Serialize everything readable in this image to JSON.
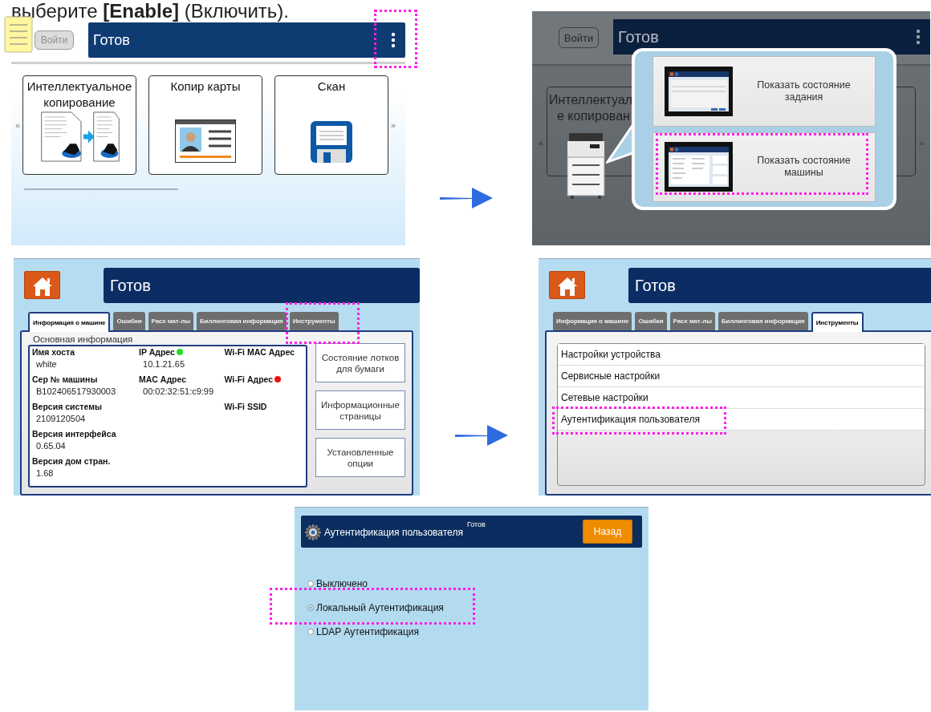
{
  "instruction": "выберите **[Enable]** (Включить).",
  "home_screen": {
    "login_button": "Войти",
    "title": "Готов",
    "menu_highlighted": true,
    "nav_prev": "«",
    "nav_next": "»",
    "cards": [
      {
        "kind": "copy",
        "label": "Интеллектуальное копирование"
      },
      {
        "kind": "id_card",
        "label": "Копир карты"
      },
      {
        "kind": "scan",
        "label": "Скан"
      }
    ]
  },
  "status_menu_screen": {
    "login_button": "Войти",
    "title": "Готов",
    "nav_prev": "«",
    "nav_next": "»",
    "card_title_lines": [
      "Интеллектуал",
      "е копирован"
    ],
    "options": [
      {
        "label": "Показать состояние задания",
        "highlighted": false
      },
      {
        "label": "Показать состояние машины",
        "highlighted": true
      }
    ]
  },
  "machine_info_screen": {
    "title": "Готов",
    "tabs": [
      {
        "label": "Информация о машине",
        "selected": true,
        "highlighted": false
      },
      {
        "label": "Ошибки",
        "selected": false,
        "highlighted": false
      },
      {
        "label": "Расх мат-лы",
        "selected": false,
        "highlighted": false
      },
      {
        "label": "Биллинговая информация",
        "selected": false,
        "highlighted": false
      },
      {
        "label": "Инструменты",
        "selected": false,
        "highlighted": true
      }
    ],
    "section_title": "Основная информация",
    "columns": [
      [
        {
          "label": "Имя хоста",
          "value": "white"
        },
        {
          "label": "Сер № машины",
          "value": "B102406517930003"
        },
        {
          "label": "Версия системы",
          "value": "2109120504"
        },
        {
          "label": "Версия интерфейса",
          "value": "0.65.04"
        },
        {
          "label": "Версия дом стран.",
          "value": "1.68"
        }
      ],
      [
        {
          "label": "IP Адрес",
          "value": "10.1.21.65",
          "color": "#22dd22"
        },
        {
          "label": "MAC Адрес",
          "value": "00:02:32:51:c9:99"
        }
      ],
      [
        {
          "label": "Wi-Fi MAC Адрес"
        },
        {
          "label": "Wi-Fi Адрес",
          "color": "#ee1111"
        },
        {
          "label": "Wi-Fi SSID"
        }
      ]
    ],
    "side_buttons": [
      "Состояние лотков для бумаги",
      "Информационные страницы",
      "Установленные опции"
    ]
  },
  "tools_screen": {
    "title": "Готов",
    "tabs": [
      {
        "label": "Информация о машине",
        "selected": false,
        "highlighted": false
      },
      {
        "label": "Ошибки",
        "selected": false,
        "highlighted": false
      },
      {
        "label": "Расх мат-лы",
        "selected": false,
        "highlighted": false
      },
      {
        "label": "Биллинговая информация",
        "selected": false,
        "highlighted": false
      },
      {
        "label": "Инструменты",
        "selected": true,
        "highlighted": false
      }
    ],
    "items": [
      {
        "label": "Настройки устройства",
        "highlighted": false
      },
      {
        "label": "Сервисные настройки",
        "highlighted": false
      },
      {
        "label": "Сетевые настройки",
        "highlighted": false
      },
      {
        "label": "Аутентификация пользователя",
        "highlighted": true
      }
    ]
  },
  "auth_screen": {
    "title": "Аутентификация пользователя",
    "status": "Готов",
    "back_button": "Назад",
    "options": [
      {
        "label": "Выключено",
        "selected": false,
        "highlighted": false
      },
      {
        "label": "Локальный Аутентификация",
        "selected": true,
        "highlighted": true
      },
      {
        "label": "LDAP Аутентификация",
        "selected": false,
        "highlighted": false
      }
    ]
  }
}
